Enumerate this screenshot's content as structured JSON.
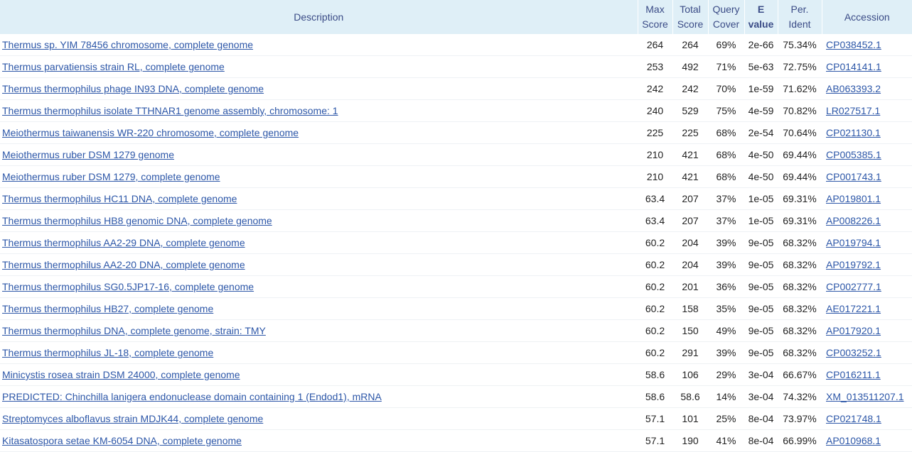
{
  "headers": {
    "description": "Description",
    "max_score": [
      "Max",
      "Score"
    ],
    "total_score": [
      "Total",
      "Score"
    ],
    "query_cover": [
      "Query",
      "Cover"
    ],
    "e_value": [
      "E",
      "value"
    ],
    "per_ident": [
      "Per.",
      "Ident"
    ],
    "accession": "Accession"
  },
  "rows": [
    {
      "description": "Thermus sp. YIM 78456 chromosome, complete genome",
      "max_score": "264",
      "total_score": "264",
      "query_cover": "69%",
      "e_value": "2e-66",
      "per_ident": "75.34%",
      "accession": "CP038452.1"
    },
    {
      "description": "Thermus parvatiensis strain RL, complete genome",
      "max_score": "253",
      "total_score": "492",
      "query_cover": "71%",
      "e_value": "5e-63",
      "per_ident": "72.75%",
      "accession": "CP014141.1"
    },
    {
      "description": "Thermus thermophilus phage IN93 DNA, complete genome",
      "max_score": "242",
      "total_score": "242",
      "query_cover": "70%",
      "e_value": "1e-59",
      "per_ident": "71.62%",
      "accession": "AB063393.2"
    },
    {
      "description": "Thermus thermophilus isolate TTHNAR1 genome assembly, chromosome: 1",
      "max_score": "240",
      "total_score": "529",
      "query_cover": "75%",
      "e_value": "4e-59",
      "per_ident": "70.82%",
      "accession": "LR027517.1"
    },
    {
      "description": "Meiothermus taiwanensis WR-220 chromosome, complete genome",
      "max_score": "225",
      "total_score": "225",
      "query_cover": "68%",
      "e_value": "2e-54",
      "per_ident": "70.64%",
      "accession": "CP021130.1"
    },
    {
      "description": "Meiothermus ruber DSM 1279 genome",
      "max_score": "210",
      "total_score": "421",
      "query_cover": "68%",
      "e_value": "4e-50",
      "per_ident": "69.44%",
      "accession": "CP005385.1"
    },
    {
      "description": "Meiothermus ruber DSM 1279, complete genome",
      "max_score": "210",
      "total_score": "421",
      "query_cover": "68%",
      "e_value": "4e-50",
      "per_ident": "69.44%",
      "accession": "CP001743.1"
    },
    {
      "description": "Thermus thermophilus HC11 DNA, complete genome",
      "max_score": "63.4",
      "total_score": "207",
      "query_cover": "37%",
      "e_value": "1e-05",
      "per_ident": "69.31%",
      "accession": "AP019801.1"
    },
    {
      "description": "Thermus thermophilus HB8 genomic DNA, complete genome",
      "max_score": "63.4",
      "total_score": "207",
      "query_cover": "37%",
      "e_value": "1e-05",
      "per_ident": "69.31%",
      "accession": "AP008226.1"
    },
    {
      "description": "Thermus thermophilus AA2-29 DNA, complete genome",
      "max_score": "60.2",
      "total_score": "204",
      "query_cover": "39%",
      "e_value": "9e-05",
      "per_ident": "68.32%",
      "accession": "AP019794.1"
    },
    {
      "description": "Thermus thermophilus AA2-20 DNA, complete genome",
      "max_score": "60.2",
      "total_score": "204",
      "query_cover": "39%",
      "e_value": "9e-05",
      "per_ident": "68.32%",
      "accession": "AP019792.1"
    },
    {
      "description": "Thermus thermophilus SG0.5JP17-16, complete genome",
      "max_score": "60.2",
      "total_score": "201",
      "query_cover": "36%",
      "e_value": "9e-05",
      "per_ident": "68.32%",
      "accession": "CP002777.1"
    },
    {
      "description": "Thermus thermophilus HB27, complete genome",
      "max_score": "60.2",
      "total_score": "158",
      "query_cover": "35%",
      "e_value": "9e-05",
      "per_ident": "68.32%",
      "accession": "AE017221.1"
    },
    {
      "description": "Thermus thermophilus DNA, complete genome, strain: TMY",
      "max_score": "60.2",
      "total_score": "150",
      "query_cover": "49%",
      "e_value": "9e-05",
      "per_ident": "68.32%",
      "accession": "AP017920.1"
    },
    {
      "description": "Thermus thermophilus JL-18, complete genome",
      "max_score": "60.2",
      "total_score": "291",
      "query_cover": "39%",
      "e_value": "9e-05",
      "per_ident": "68.32%",
      "accession": "CP003252.1"
    },
    {
      "description": "Minicystis rosea strain DSM 24000, complete genome",
      "max_score": "58.6",
      "total_score": "106",
      "query_cover": "29%",
      "e_value": "3e-04",
      "per_ident": "66.67%",
      "accession": "CP016211.1"
    },
    {
      "description": "PREDICTED: Chinchilla lanigera endonuclease domain containing 1 (Endod1), mRNA",
      "max_score": "58.6",
      "total_score": "58.6",
      "query_cover": "14%",
      "e_value": "3e-04",
      "per_ident": "74.32%",
      "accession": "XM_013511207.1"
    },
    {
      "description": "Streptomyces alboflavus strain MDJK44, complete genome",
      "max_score": "57.1",
      "total_score": "101",
      "query_cover": "25%",
      "e_value": "8e-04",
      "per_ident": "73.97%",
      "accession": "CP021748.1"
    },
    {
      "description": "Kitasatospora setae KM-6054 DNA, complete genome",
      "max_score": "57.1",
      "total_score": "190",
      "query_cover": "41%",
      "e_value": "8e-04",
      "per_ident": "66.99%",
      "accession": "AP010968.1"
    }
  ]
}
